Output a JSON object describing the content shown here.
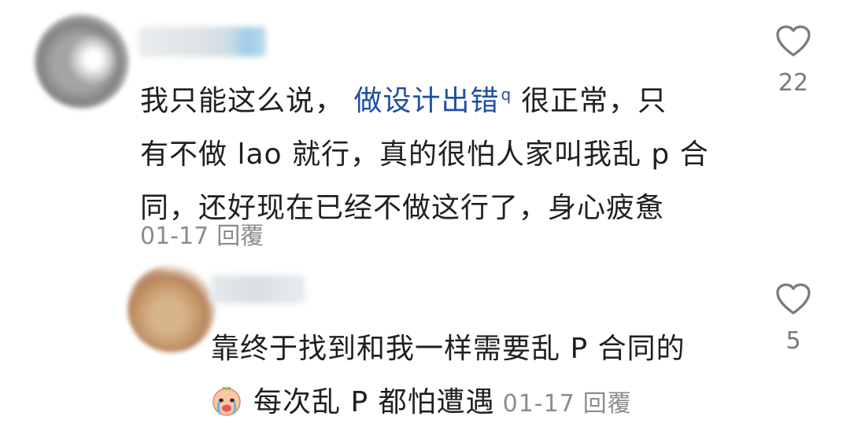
{
  "comment": {
    "line1_before": "我只能这么说， ",
    "link": "做设计出错",
    "link_icon": "search-icon",
    "line1_after": "很正常，只",
    "line2": "有不做 lao 就行，真的很怕人家叫我乱 p 合",
    "line3": "同，还好现在已经不做这行了，身心疲惫",
    "date": "01-17",
    "reply_label": "回覆",
    "likes": "22"
  },
  "reply": {
    "line1": "靠终于找到和我一样需要乱 P 合同的",
    "emoji": "crying-face-emoji",
    "line2": "每次乱 P 都怕遭遇",
    "date": "01-17",
    "reply_label": "回覆",
    "likes": "5"
  },
  "colors": {
    "text": "#1f1f1f",
    "link": "#1f4fa0",
    "meta": "#8c8c8c"
  }
}
